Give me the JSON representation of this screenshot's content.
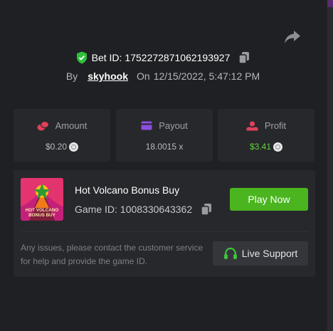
{
  "bet": {
    "label": "Bet ID:",
    "id": "1752272871062193927",
    "by_label": "By",
    "username": "skyhook",
    "on_label": "On",
    "date": "12/15/2022, 5:47:12 PM"
  },
  "stats": {
    "amount": {
      "label": "Amount",
      "value": "$0.20",
      "icon": "coins-icon",
      "color": "#e0415a"
    },
    "payout": {
      "label": "Payout",
      "value": "18.0015 x",
      "icon": "card-icon",
      "color": "#8c4de0"
    },
    "profit": {
      "label": "Profit",
      "value": "$3.41",
      "icon": "hand-coin-icon",
      "color": "#e0415a",
      "value_color": "#5fd13a"
    }
  },
  "game": {
    "name": "Hot Volcano Bonus Buy",
    "id_label": "Game ID:",
    "id": "1008330643362",
    "thumb_text": [
      "HOT VOLCANO",
      "BONUS BUY"
    ],
    "play_label": "Play Now"
  },
  "support": {
    "notice": "Any issues, please contact the customer service for help and provide the game ID.",
    "button_label": "Live Support"
  },
  "colors": {
    "background": "#1f2023",
    "card": "#27282c",
    "accent_green": "#4bb51f",
    "shield_green": "#2fbf3a"
  }
}
